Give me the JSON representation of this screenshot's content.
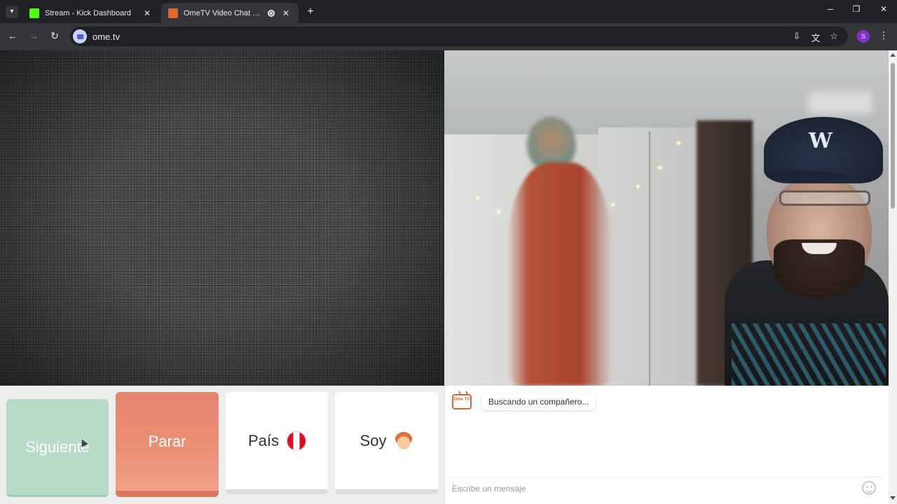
{
  "browser": {
    "tabs": [
      {
        "title": "Stream - Kick Dashboard",
        "favicon_color": "#53fc18"
      },
      {
        "title": "OmeTV Video Chat — Ome",
        "favicon_color": "#e0672e",
        "active": true
      }
    ],
    "url": "ome.tv",
    "profile_initial": "S",
    "icons": {
      "tab_search": "chevron-down-icon",
      "close": "close-icon",
      "new_tab": "plus-icon",
      "back": "arrow-left-icon",
      "forward": "arrow-right-icon",
      "reload": "reload-icon",
      "install": "install-app-icon",
      "translate": "translate-icon",
      "bookmark": "star-icon",
      "menu": "kebab-menu-icon"
    }
  },
  "controls": {
    "next_label": "Siguiente",
    "stop_label": "Parar",
    "country_label": "País",
    "gender_label": "Soy"
  },
  "chat": {
    "logo_text": "Ome TV",
    "status_message": "Buscando un compañero...",
    "input_placeholder": "Escribe un mensaje"
  },
  "colors": {
    "next_button": "#b7dbc6",
    "stop_button": "#ea8f74",
    "brand_orange": "#e0672e"
  }
}
